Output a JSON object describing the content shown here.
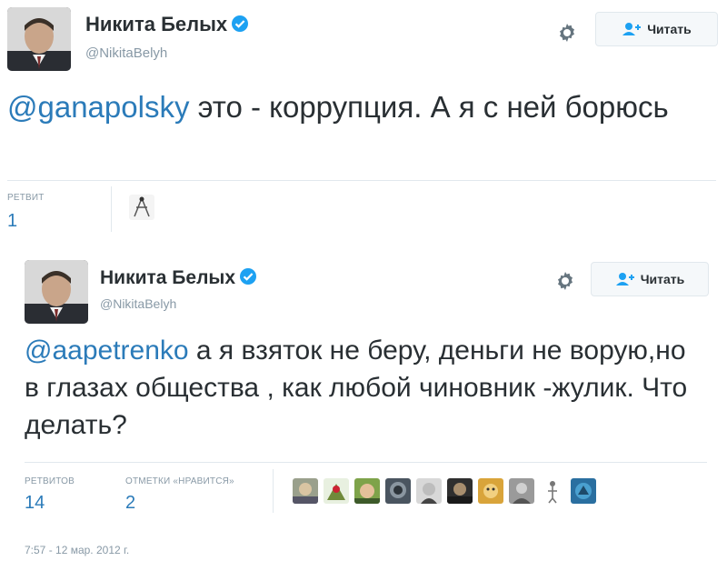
{
  "tweets": [
    {
      "author_name": "Никита Белых",
      "handle": "@NikitaBelyh",
      "follow_label": "Читать",
      "mention": "@ganapolsky",
      "text": " это - коррупция. А я с ней борюсь",
      "stats": {
        "retweets_label": "РЕТВИТ",
        "retweets": "1"
      },
      "avatars": [
        "avatar-1"
      ]
    },
    {
      "author_name": "Никита Белых",
      "handle": "@NikitaBelyh",
      "follow_label": "Читать",
      "mention": "@aapetrenko",
      "text": " а я взяток не беру, деньги не ворую,но в глазах общества , как любой чиновник -жулик. Что делать?",
      "stats": {
        "retweets_label": "РЕТВИТОВ",
        "retweets": "14",
        "likes_label": "ОТМЕТКИ «НРАВИТСЯ»",
        "likes": "2"
      },
      "avatars": [
        "avatar-1",
        "avatar-2",
        "avatar-3",
        "avatar-4",
        "avatar-5",
        "avatar-6",
        "avatar-7",
        "avatar-8",
        "avatar-9",
        "avatar-10"
      ],
      "timestamp": "7:57 - 12 мар. 2012 г."
    }
  ],
  "colors": {
    "link": "#2b7bb9",
    "muted": "#8899a6",
    "text": "#292f33",
    "verified": "#1da1f2"
  },
  "icons": {
    "verified": "verified-badge-icon",
    "gear": "gear-icon",
    "follow": "add-user-icon"
  }
}
